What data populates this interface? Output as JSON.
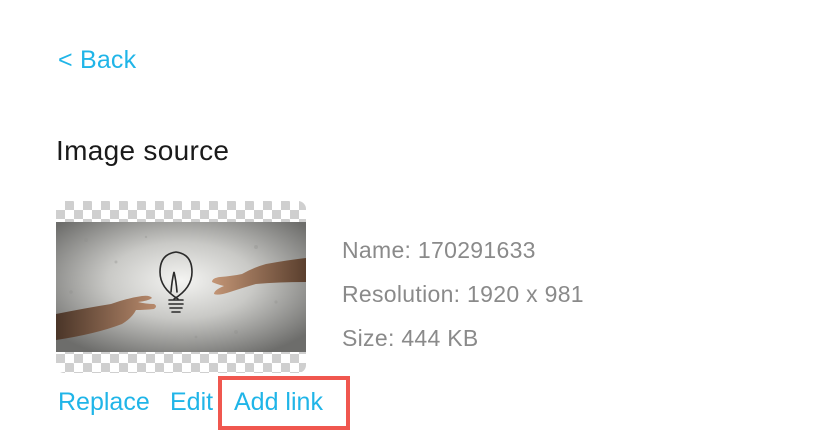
{
  "nav": {
    "back_label": "< Back"
  },
  "section": {
    "title": "Image source"
  },
  "image_info": {
    "name_label": "Name: 170291633",
    "resolution_label": "Resolution: 1920 x 981",
    "size_label": "Size: 444 KB"
  },
  "actions": {
    "replace_label": "Replace",
    "edit_label": "Edit",
    "add_link_label": "Add link"
  },
  "colors": {
    "link": "#20b5e8",
    "highlight": "#f0574f",
    "meta_text": "#8a8a8a",
    "title_text": "#1a1a1a"
  }
}
